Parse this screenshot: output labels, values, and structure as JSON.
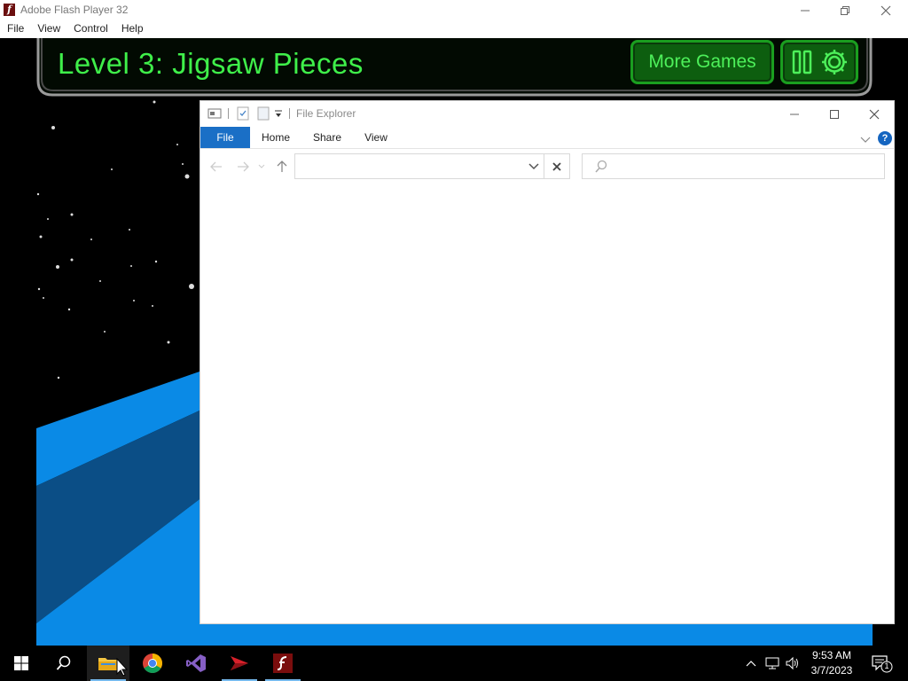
{
  "flash": {
    "title": "Adobe Flash Player 32",
    "app_icon_glyph": "f",
    "menu": [
      "File",
      "View",
      "Control",
      "Help"
    ]
  },
  "game": {
    "level_title": "Level 3: Jigsaw Pieces",
    "more_games_label": "More Games"
  },
  "explorer": {
    "title": "File Explorer",
    "tabs": {
      "file": "File",
      "home": "Home",
      "share": "Share",
      "view": "View"
    },
    "help_glyph": "?",
    "address_value": "",
    "search_placeholder": ""
  },
  "taskbar": {
    "time": "9:53 AM",
    "date": "3/7/2023",
    "notification_count": "1",
    "apps": [
      "start-icon",
      "search-icon",
      "file-explorer-icon",
      "chrome-icon",
      "visual-studio-icon",
      "app-red-arrow-icon",
      "flash-player-icon"
    ]
  },
  "colors": {
    "hud_green": "#3fef4a",
    "button_green": "#0d5e0f",
    "explorer_accent": "#1a6fc6",
    "game_blue": "#0a8ae6"
  }
}
